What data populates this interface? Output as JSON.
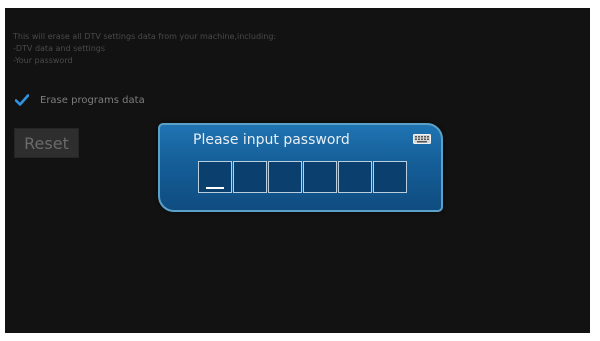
{
  "settings": {
    "description": [
      "This will erase all DTV settings data from your machine,including:",
      "-DTV data and settings",
      "-Your password"
    ],
    "erase_programs": {
      "label": "Erase programs data",
      "checked": true
    },
    "reset_label": "Reset"
  },
  "password_dialog": {
    "title": "Please input password",
    "icon": "keyboard-icon",
    "pin_length": 6,
    "active_index": 0
  },
  "colors": {
    "checkmark": "#2f95e0",
    "dialog_blue": "#1a68a8",
    "background": "#121212"
  }
}
